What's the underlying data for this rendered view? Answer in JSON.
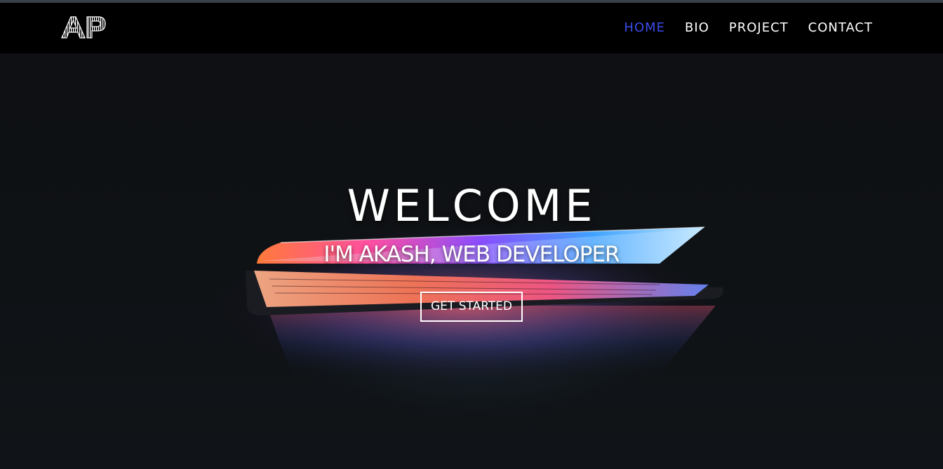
{
  "brand": {
    "logo_text": "AP"
  },
  "nav": {
    "items": [
      {
        "label": "HOME",
        "active": true
      },
      {
        "label": "BIO",
        "active": false
      },
      {
        "label": "PROJECT",
        "active": false
      },
      {
        "label": "CONTACT",
        "active": false
      }
    ]
  },
  "hero": {
    "title": "WELCOME",
    "subtitle": "I'M AKASH, WEB DEVELOPER",
    "cta_label": "GET STARTED"
  },
  "colors": {
    "navbar_bg": "#000000",
    "active_nav": "#3a4de8",
    "text": "#ffffff",
    "hero_bg": "#0e1013"
  }
}
